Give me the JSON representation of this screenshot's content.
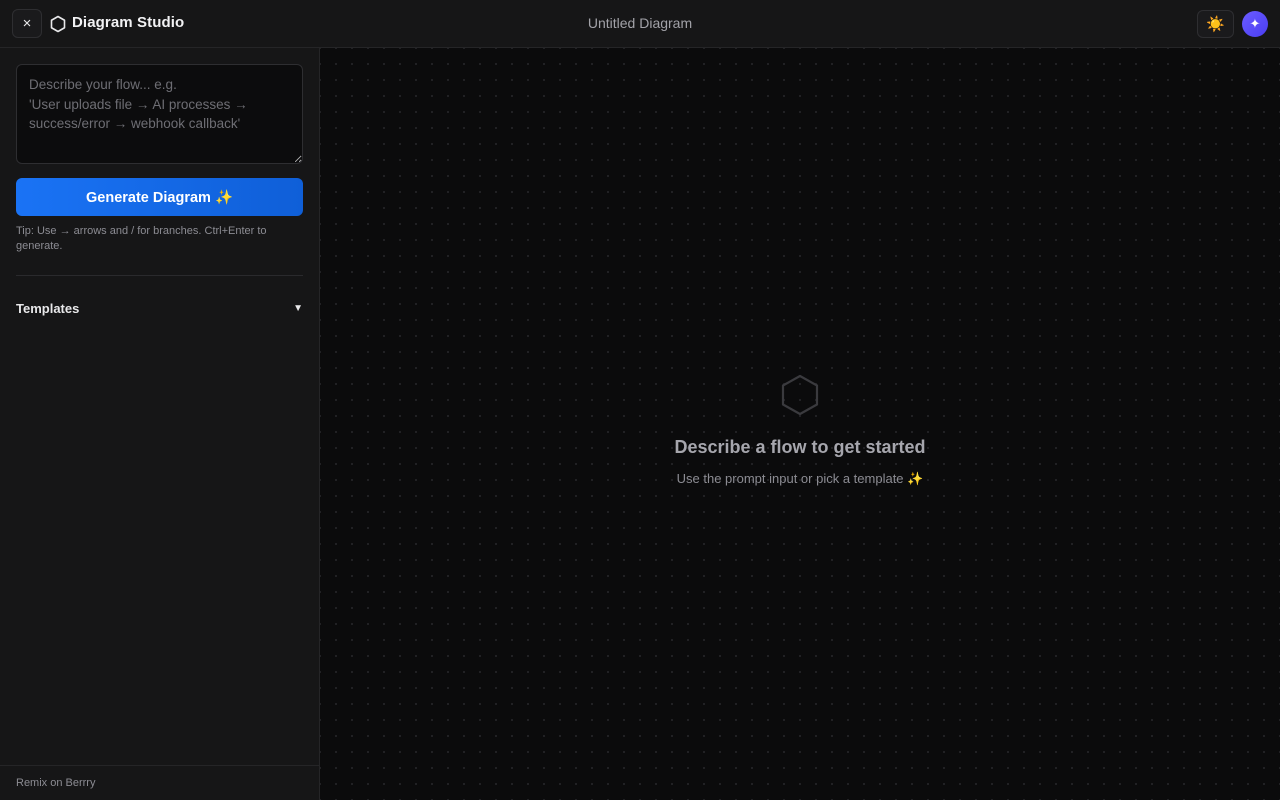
{
  "header": {
    "close_icon": "×",
    "app_title": "Diagram Studio",
    "doc_title": "Untitled Diagram",
    "theme_icon": "☀️",
    "ai_icon": "✦"
  },
  "sidebar": {
    "prompt_placeholder": "Describe your flow... e.g.\n'User uploads file → AI processes → success/error → webhook callback'",
    "prompt_value": "",
    "generate_label": "Generate Diagram ✨",
    "tip": "Tip: Use → arrows and / for branches. Ctrl+Enter to generate.",
    "templates_label": "Templates",
    "templates_chevron": "▼",
    "footer_link": "Remix on Berrry"
  },
  "canvas": {
    "empty_title": "Describe a flow to get started",
    "empty_subtitle": "Use the prompt input or pick a template ✨"
  },
  "colors": {
    "accent": "#1a73f5",
    "ai_badge": "#5b4cf7",
    "background": "#0b0b0c",
    "panel": "#161617"
  },
  "icons": [
    "close-icon",
    "hexagon-logo-icon",
    "sun-icon",
    "sparkle-icon",
    "chevron-down-icon",
    "hexagon-empty-icon"
  ]
}
